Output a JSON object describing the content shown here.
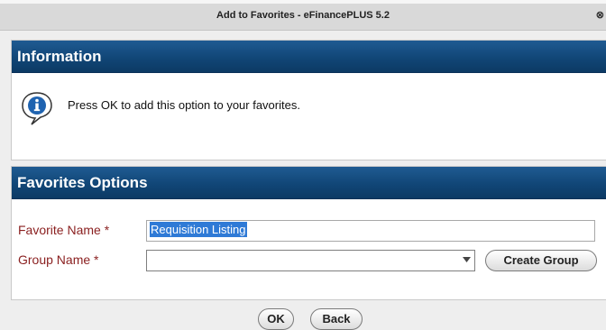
{
  "window": {
    "title": "Add to Favorites - eFinancePLUS 5.2",
    "close_icon": "close-icon"
  },
  "info_section": {
    "header": "Information",
    "icon": "info-icon",
    "message": "Press OK to add this option to your favorites."
  },
  "favorites_section": {
    "header": "Favorites Options",
    "favorite_name": {
      "label": "Favorite Name *",
      "value": "Requisition Listing"
    },
    "group_name": {
      "label": "Group Name *",
      "value": "",
      "dropdown_icon": "chevron-down-icon"
    },
    "create_group_label": "Create Group"
  },
  "footer": {
    "ok_label": "OK",
    "back_label": "Back"
  }
}
